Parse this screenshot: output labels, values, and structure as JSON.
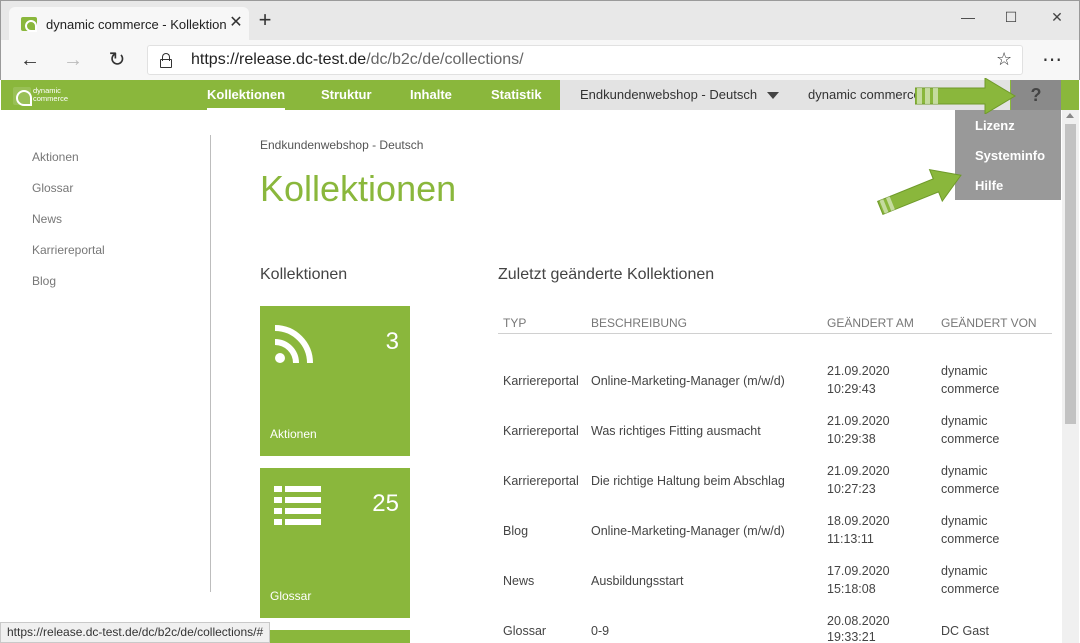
{
  "browser": {
    "tab_title": "dynamic commerce - Kollektionen",
    "tab_close": "✕",
    "new_tab": "+",
    "url_host": "https://release.dc-test.de",
    "url_path": "/dc/b2c/de/collections/",
    "status_url": "https://release.dc-test.de/dc/b2c/de/collections/#",
    "icons": [
      "back-icon",
      "forward-icon",
      "refresh-icon",
      "lock-icon",
      "favorite-star-icon",
      "more-icon",
      "minimize-icon",
      "maximize-icon",
      "close-icon"
    ]
  },
  "appbar": {
    "logo_text": "dynamic commerce",
    "nav": [
      "Kollektionen",
      "Struktur",
      "Inhalte",
      "Statistik"
    ],
    "active_nav": "Kollektionen",
    "shop_select": "Endkundenwebshop - Deutsch",
    "user": "dynamic commerce",
    "help": "?"
  },
  "help_menu": {
    "items": [
      "Lizenz",
      "Systeminfo",
      "Hilfe"
    ]
  },
  "sidebar": {
    "items": [
      "Aktionen",
      "Glossar",
      "News",
      "Karriereportal",
      "Blog"
    ]
  },
  "main": {
    "breadcrumb": "Endkundenwebshop - Deutsch",
    "title": "Kollektionen",
    "left_heading": "Kollektionen",
    "tiles": [
      {
        "label": "Aktionen",
        "count": "3",
        "icon": "rss-icon"
      },
      {
        "label": "Glossar",
        "count": "25",
        "icon": "list-icon"
      }
    ],
    "right_heading": "Zuletzt geänderte Kollektionen",
    "table": {
      "columns": [
        "TYP",
        "BESCHREIBUNG",
        "GEÄNDERT AM",
        "GEÄNDERT VON"
      ],
      "rows": [
        {
          "typ": "Karriereportal",
          "beschreibung": "Online-Marketing-Manager (m/w/d)",
          "datum": "21.09.2020",
          "zeit": "10:29:43",
          "von1": "dynamic",
          "von2": "commerce"
        },
        {
          "typ": "Karriereportal",
          "beschreibung": "Was richtiges Fitting ausmacht",
          "datum": "21.09.2020",
          "zeit": "10:29:38",
          "von1": "dynamic",
          "von2": "commerce"
        },
        {
          "typ": "Karriereportal",
          "beschreibung": "Die richtige Haltung beim Abschlag",
          "datum": "21.09.2020",
          "zeit": "10:27:23",
          "von1": "dynamic",
          "von2": "commerce"
        },
        {
          "typ": "Blog",
          "beschreibung": "Online-Marketing-Manager (m/w/d)",
          "datum": "18.09.2020",
          "zeit": "11:13:11",
          "von1": "dynamic",
          "von2": "commerce"
        },
        {
          "typ": "News",
          "beschreibung": "Ausbildungsstart",
          "datum": "17.09.2020",
          "zeit": "15:18:08",
          "von1": "dynamic",
          "von2": "commerce"
        },
        {
          "typ": "Glossar",
          "beschreibung": "0-9",
          "datum": "20.08.2020",
          "zeit": "19:33:21",
          "von1": "DC Gast",
          "von2": ""
        }
      ]
    }
  },
  "colors": {
    "brand_green": "#8ab73c",
    "nav_grey": "#e3e3e3",
    "menu_grey": "#999999"
  }
}
